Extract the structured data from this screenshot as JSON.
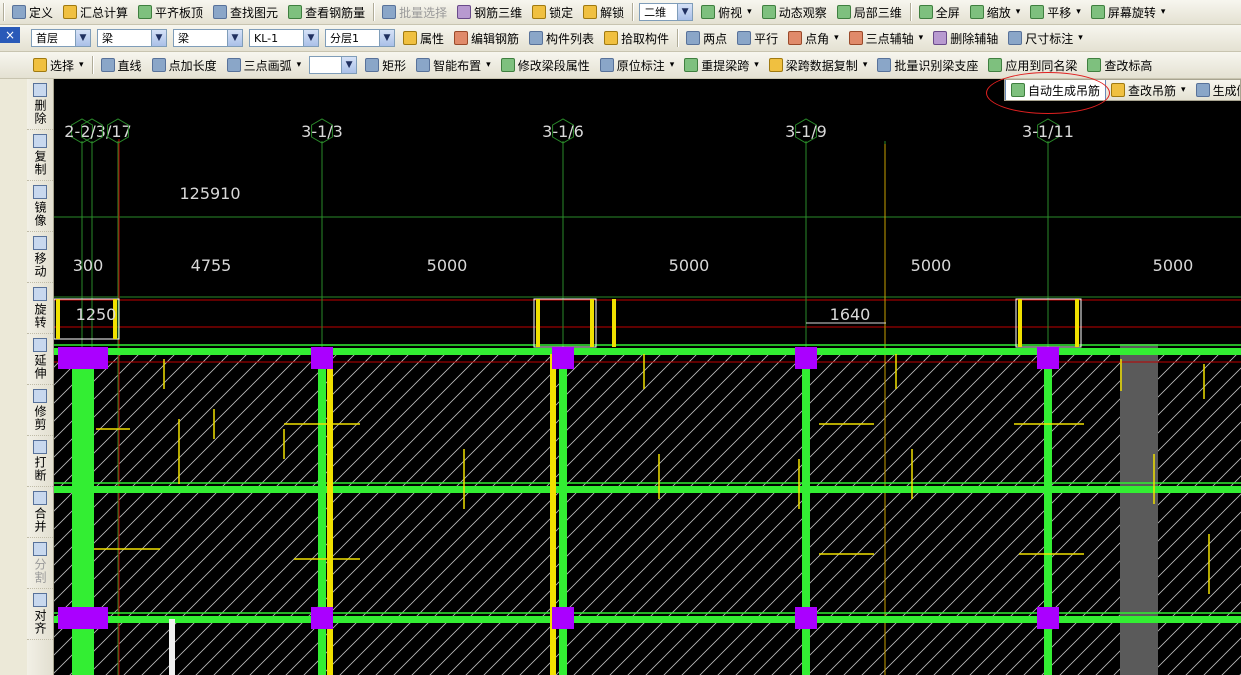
{
  "toolbar_main": {
    "items": [
      {
        "label": "定义",
        "icon": "define-icon",
        "enabled": true
      },
      {
        "label": "汇总计算",
        "icon": "sigma-icon",
        "enabled": true
      },
      {
        "label": "平齐板顶",
        "icon": "align-slab-icon",
        "enabled": true
      },
      {
        "label": "查找图元",
        "icon": "binoculars-icon",
        "enabled": true
      },
      {
        "label": "查看钢筋量",
        "icon": "rebar-view-icon",
        "enabled": true
      },
      {
        "label": "批量选择",
        "icon": "batch-select-icon",
        "enabled": false
      },
      {
        "label": "钢筋三维",
        "icon": "rebar-3d-icon",
        "enabled": true
      },
      {
        "label": "锁定",
        "icon": "lock-icon",
        "enabled": true
      },
      {
        "label": "解锁",
        "icon": "unlock-icon",
        "enabled": true
      }
    ],
    "view_mode": "二维",
    "view_items": [
      {
        "label": "俯视",
        "icon": "top-view-icon",
        "dropdown": true
      },
      {
        "label": "动态观察",
        "icon": "orbit-icon",
        "dropdown": false
      },
      {
        "label": "局部三维",
        "icon": "local-3d-icon",
        "dropdown": false
      },
      {
        "label": "全屏",
        "icon": "fullscreen-icon",
        "dropdown": false
      },
      {
        "label": "缩放",
        "icon": "zoom-icon",
        "dropdown": true
      },
      {
        "label": "平移",
        "icon": "pan-icon",
        "dropdown": true
      },
      {
        "label": "屏幕旋转",
        "icon": "rotate-screen-icon",
        "dropdown": true
      }
    ]
  },
  "toolbar_selector": {
    "floor": "首层",
    "category": "梁",
    "type": "梁",
    "component": "KL-1",
    "layer": "分层1",
    "items": [
      {
        "label": "属性",
        "icon": "properties-icon"
      },
      {
        "label": "编辑钢筋",
        "icon": "edit-rebar-icon"
      },
      {
        "label": "构件列表",
        "icon": "component-list-icon"
      },
      {
        "label": "拾取构件",
        "icon": "pick-icon"
      },
      {
        "label": "两点",
        "icon": "two-point-axis-icon"
      },
      {
        "label": "平行",
        "icon": "parallel-axis-icon"
      },
      {
        "label": "点角",
        "icon": "point-angle-icon",
        "dropdown": true
      },
      {
        "label": "三点辅轴",
        "icon": "three-point-axis-icon",
        "dropdown": true
      },
      {
        "label": "删除辅轴",
        "icon": "delete-axis-icon"
      },
      {
        "label": "尺寸标注",
        "icon": "dimension-icon",
        "dropdown": true
      }
    ]
  },
  "toolbar_draw": {
    "select_label": "选择",
    "items": [
      {
        "label": "直线",
        "icon": "line-icon"
      },
      {
        "label": "点加长度",
        "icon": "point-length-icon"
      },
      {
        "label": "三点画弧",
        "icon": "arc-icon",
        "dropdown": true
      }
    ],
    "rect_label": "矩形",
    "items2": [
      {
        "label": "智能布置",
        "icon": "smart-layout-icon",
        "dropdown": true
      },
      {
        "label": "修改梁段属性",
        "icon": "modify-beam-icon"
      },
      {
        "label": "原位标注",
        "icon": "in-situ-mark-icon",
        "dropdown": true
      },
      {
        "label": "重提梁跨",
        "icon": "recalc-span-icon",
        "dropdown": true
      },
      {
        "label": "梁跨数据复制",
        "icon": "copy-span-icon",
        "dropdown": true
      },
      {
        "label": "批量识别梁支座",
        "icon": "identify-support-icon"
      },
      {
        "label": "应用到同名梁",
        "icon": "apply-same-icon"
      },
      {
        "label": "查改标高",
        "icon": "elevation-icon"
      }
    ]
  },
  "toolbar_hanger": {
    "auto_label": "自动生成吊筋",
    "check_label": "查改吊筋",
    "gen_label": "生成侧面钢筋"
  },
  "left_tools": [
    {
      "label": "删除",
      "icon": "delete-icon",
      "enabled": true
    },
    {
      "label": "复制",
      "icon": "copy-icon",
      "enabled": true
    },
    {
      "label": "镜像",
      "icon": "mirror-icon",
      "enabled": true
    },
    {
      "label": "移动",
      "icon": "move-icon",
      "enabled": true
    },
    {
      "label": "旋转",
      "icon": "rotate-icon",
      "enabled": true
    },
    {
      "label": "延伸",
      "icon": "extend-icon",
      "enabled": true
    },
    {
      "label": "修剪",
      "icon": "trim-icon",
      "enabled": true
    },
    {
      "label": "打断",
      "icon": "break-icon",
      "enabled": true
    },
    {
      "label": "合并",
      "icon": "merge-icon",
      "enabled": true
    },
    {
      "label": "分割",
      "icon": "split-icon",
      "enabled": false
    },
    {
      "label": "对齐",
      "icon": "align-icon",
      "enabled": true
    }
  ],
  "drawing": {
    "axis_labels": [
      "2-2/3/17",
      "3-1/3",
      "3-1/6",
      "3-1/9",
      "3-1/11"
    ],
    "total_dimension": "125910",
    "span_dimensions": [
      "300",
      "4755",
      "5000",
      "5000",
      "5000",
      "5000"
    ],
    "local_dimension": "1640",
    "small_dimension": "1250",
    "colors": {
      "background": "#000000",
      "beam": "#33ee33",
      "rebar": "#f0e000",
      "column": "#aa00ff",
      "axis": "#2a8a2a",
      "dimension_text": "#d8d8d8",
      "red_line": "#c00000",
      "gray_band": "#5a5a5a"
    }
  }
}
